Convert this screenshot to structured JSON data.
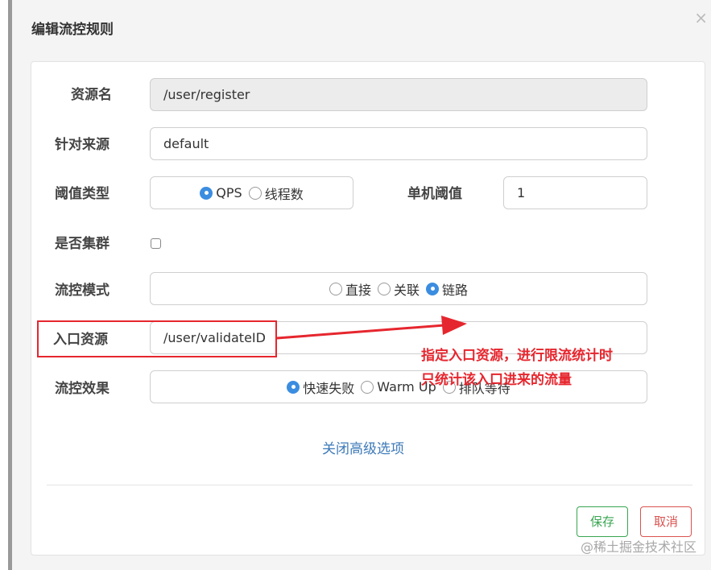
{
  "dialog": {
    "title": "编辑流控规则",
    "close_label": "×"
  },
  "form": {
    "resource": {
      "label": "资源名",
      "value": "/user/register"
    },
    "limit_app": {
      "label": "针对来源",
      "value": "default"
    },
    "threshold_type": {
      "label": "阈值类型",
      "options": [
        "QPS",
        "线程数"
      ],
      "selected": "QPS"
    },
    "single_threshold": {
      "label": "单机阈值",
      "value": "1"
    },
    "cluster": {
      "label": "是否集群",
      "checked": false
    },
    "strategy": {
      "label": "流控模式",
      "options": [
        "直接",
        "关联",
        "链路"
      ],
      "selected": "链路"
    },
    "ref_resource": {
      "label": "入口资源",
      "value": "/user/validateID"
    },
    "control_behavior": {
      "label": "流控效果",
      "options": [
        "快速失败",
        "Warm Up",
        "排队等待"
      ],
      "selected": "快速失败"
    },
    "advanced_toggle": "关闭高级选项"
  },
  "buttons": {
    "save": "保存",
    "cancel": "取消"
  },
  "annotation": {
    "line1": "指定入口资源，进行限流统计时",
    "line2": "只统计该入口进来的流量",
    "color": "#e6262e"
  },
  "watermark": "@稀土掘金技术社区",
  "colors": {
    "accent": "#3b8de0",
    "save": "#38a551",
    "cancel": "#d9534f",
    "link": "#3d7ab8"
  }
}
